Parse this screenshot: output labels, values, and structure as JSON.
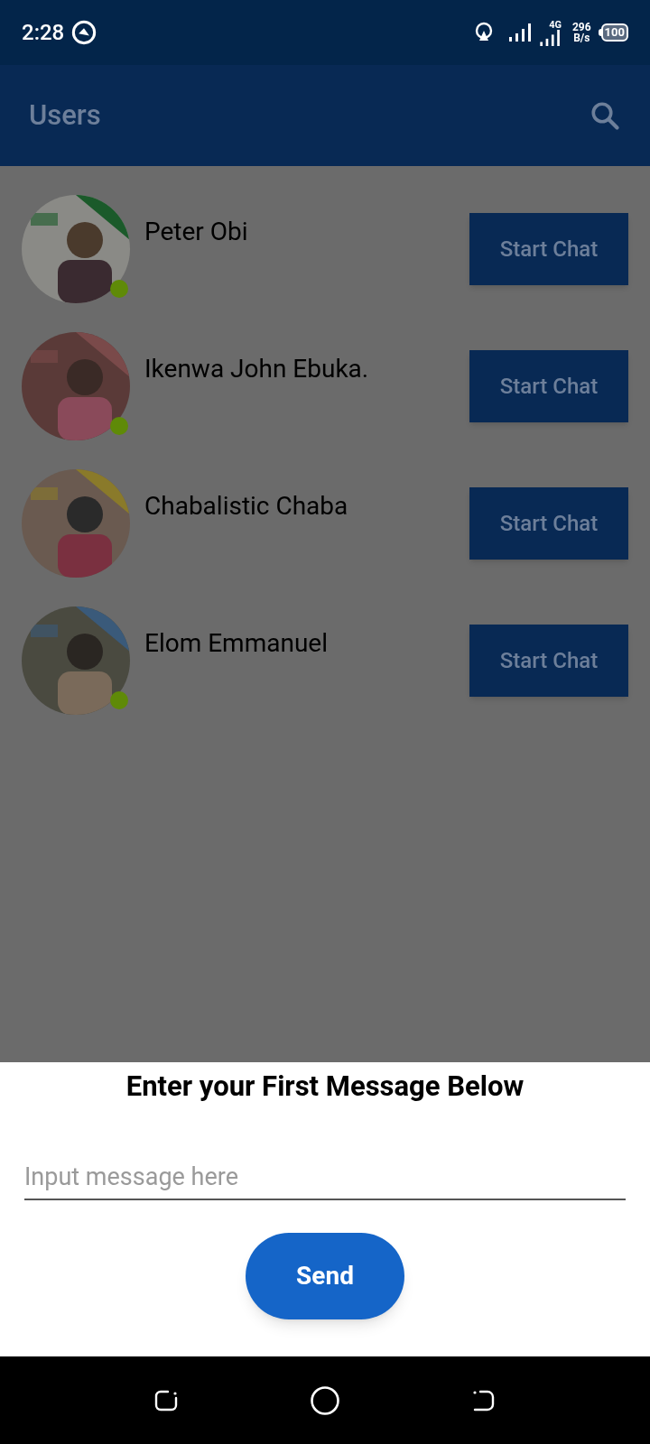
{
  "status_bar": {
    "time": "2:28",
    "network_type": "4G",
    "speed_value": "296",
    "speed_unit": "B/s",
    "battery": "100"
  },
  "app_bar": {
    "title": "Users"
  },
  "users": [
    {
      "name": "Peter Obi",
      "online": true,
      "button": "Start Chat"
    },
    {
      "name": "Ikenwa John Ebuka.",
      "online": true,
      "button": "Start Chat"
    },
    {
      "name": "Chabalistic Chaba",
      "online": false,
      "button": "Start Chat"
    },
    {
      "name": "Elom Emmanuel",
      "online": true,
      "button": "Start Chat"
    }
  ],
  "sheet": {
    "title": "Enter your First Message Below",
    "placeholder": "Input message here",
    "button": "Send"
  }
}
